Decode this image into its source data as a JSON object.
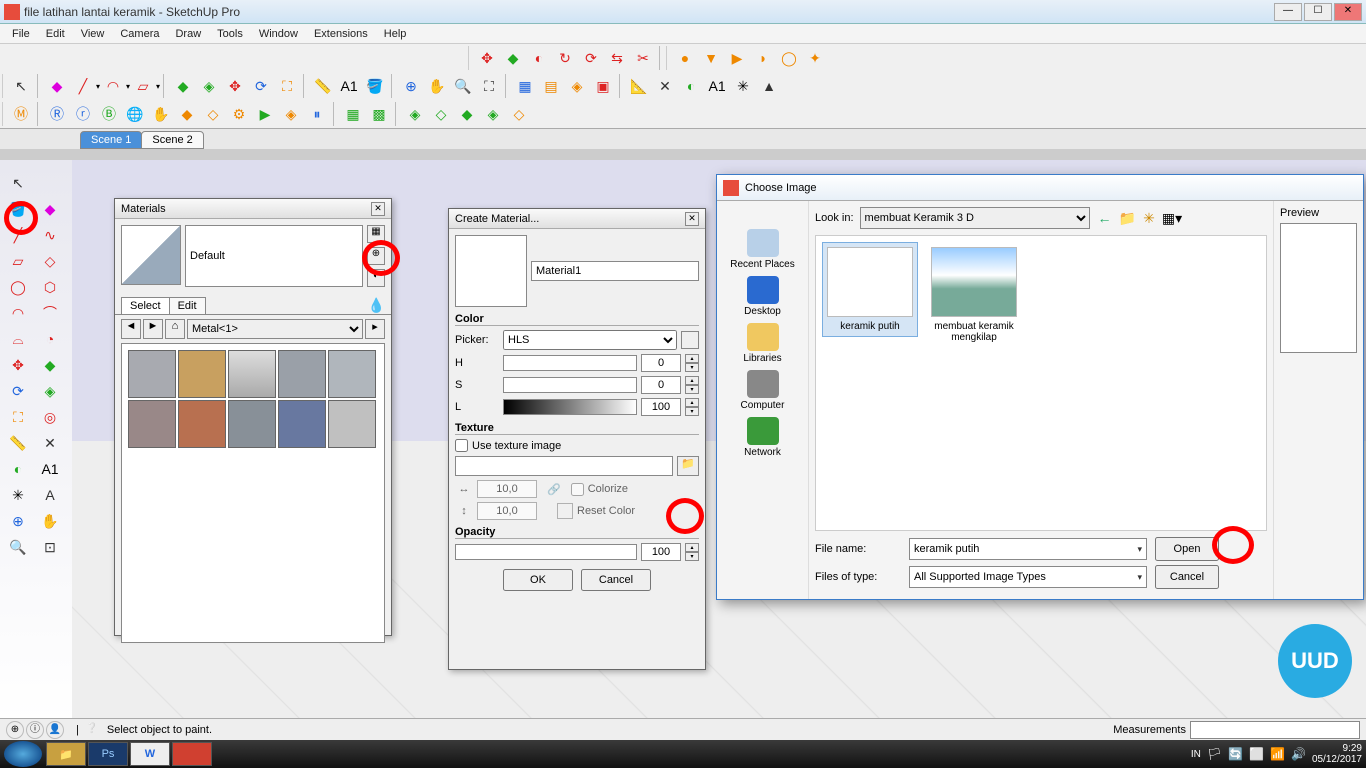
{
  "window": {
    "title": "file latihan lantai keramik - SketchUp Pro"
  },
  "menubar": {
    "items": [
      "File",
      "Edit",
      "View",
      "Camera",
      "Draw",
      "Tools",
      "Window",
      "Extensions",
      "Help"
    ]
  },
  "scene_tabs": {
    "items": [
      "Scene 1",
      "Scene 2"
    ],
    "active": 0
  },
  "materials_panel": {
    "title": "Materials",
    "current_name": "Default",
    "select_tab": "Select",
    "edit_tab": "Edit",
    "library_combo": "Metal<1>"
  },
  "create_material": {
    "title": "Create Material...",
    "name_value": "Material1",
    "color_label": "Color",
    "picker_label": "Picker:",
    "picker_value": "HLS",
    "h_label": "H",
    "h_value": "0",
    "s_label": "S",
    "s_value": "0",
    "l_label": "L",
    "l_value": "100",
    "texture_label": "Texture",
    "use_texture_label": "Use texture image",
    "w_value": "10,0",
    "h2_value": "10,0",
    "colorize_label": "Colorize",
    "reset_label": "Reset Color",
    "opacity_label": "Opacity",
    "opacity_value": "100",
    "ok": "OK",
    "cancel": "Cancel"
  },
  "choose_image": {
    "title": "Choose Image",
    "lookin_label": "Look in:",
    "lookin_value": "membuat Keramik 3 D",
    "places": [
      "Recent Places",
      "Desktop",
      "Libraries",
      "Computer",
      "Network"
    ],
    "files": [
      {
        "name": "keramik putih",
        "selected": true
      },
      {
        "name": "membuat keramik mengkilap",
        "selected": false
      }
    ],
    "filename_label": "File name:",
    "filename_value": "keramik putih",
    "filetype_label": "Files of type:",
    "filetype_value": "All Supported Image Types",
    "open": "Open",
    "cancel": "Cancel",
    "preview_label": "Preview"
  },
  "statusbar": {
    "hint": "Select object to paint.",
    "measurements_label": "Measurements"
  },
  "taskbar": {
    "lang": "IN",
    "time": "9:29",
    "date": "05/12/2017"
  },
  "uud_badge": "UUD"
}
